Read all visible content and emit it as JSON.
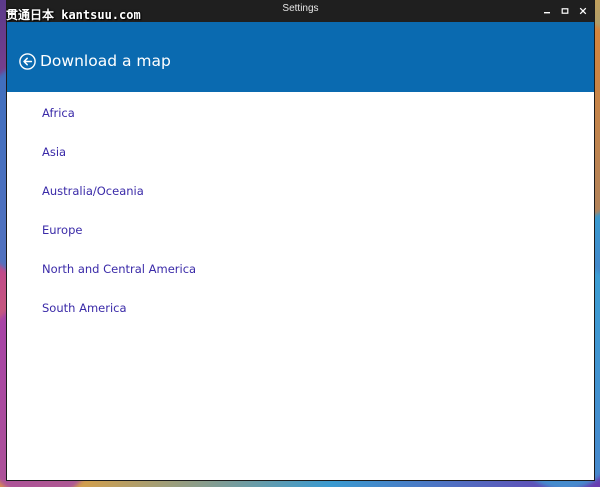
{
  "watermark": "贯通日本 kantsuu.com",
  "window": {
    "title": "Settings",
    "caption_buttons": {
      "minimize_icon": "minimize-icon",
      "maximize_icon": "maximize-icon",
      "close_icon": "close-icon"
    }
  },
  "header": {
    "back_icon": "back-arrow-circle-icon",
    "title": "Download a map"
  },
  "regions": [
    {
      "label": "Africa"
    },
    {
      "label": "Asia"
    },
    {
      "label": "Australia/Oceania"
    },
    {
      "label": "Europe"
    },
    {
      "label": "North and Central America"
    },
    {
      "label": "South America"
    }
  ],
  "colors": {
    "header_bg": "#0a6ab0",
    "titlebar_bg": "#1f1f1f",
    "link_text": "#3a2aa8",
    "window_bg": "#ffffff"
  }
}
